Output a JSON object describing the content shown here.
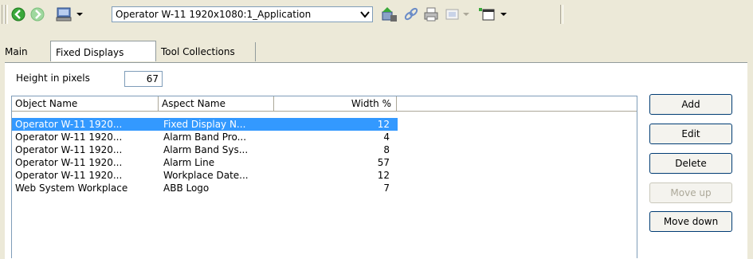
{
  "toolbar": {
    "back_icon": "back-arrow-green",
    "forward_icon": "forward-arrow-green-disabled",
    "computer_icon": "computer-icon",
    "combo_value": "Operator W-11 1920x1080:1_Application",
    "icons": [
      "network-icon",
      "link-icon",
      "print-icon",
      "view-icon",
      "window-icon"
    ]
  },
  "tabs": [
    {
      "label": "Main",
      "active": false
    },
    {
      "label": "Fixed Displays",
      "active": true
    },
    {
      "label": "Tool Collections",
      "active": false
    }
  ],
  "height": {
    "label": "Height in pixels",
    "value": "67"
  },
  "table": {
    "columns": [
      "Object Name",
      "Aspect Name",
      "Width %"
    ],
    "rows": [
      {
        "object": "Operator W-11 1920...",
        "aspect": "Fixed Display N...",
        "width": "12",
        "selected": true
      },
      {
        "object": "Operator W-11 1920...",
        "aspect": "Alarm Band Pro...",
        "width": "4",
        "selected": false
      },
      {
        "object": "Operator W-11 1920...",
        "aspect": "Alarm Band Sys...",
        "width": "8",
        "selected": false
      },
      {
        "object": "Operator W-11 1920...",
        "aspect": "Alarm Line",
        "width": "57",
        "selected": false
      },
      {
        "object": "Operator W-11 1920...",
        "aspect": "Workplace Date...",
        "width": "12",
        "selected": false
      },
      {
        "object": "Web System Workplace",
        "aspect": "ABB Logo",
        "width": "7",
        "selected": false
      }
    ]
  },
  "buttons": {
    "add": "Add",
    "edit": "Edit",
    "delete": "Delete",
    "move_up": "Move up",
    "move_down": "Move down"
  },
  "colors": {
    "selection": "#3399ff",
    "window": "#ece9d8",
    "accent_green": "#3aa83a"
  }
}
